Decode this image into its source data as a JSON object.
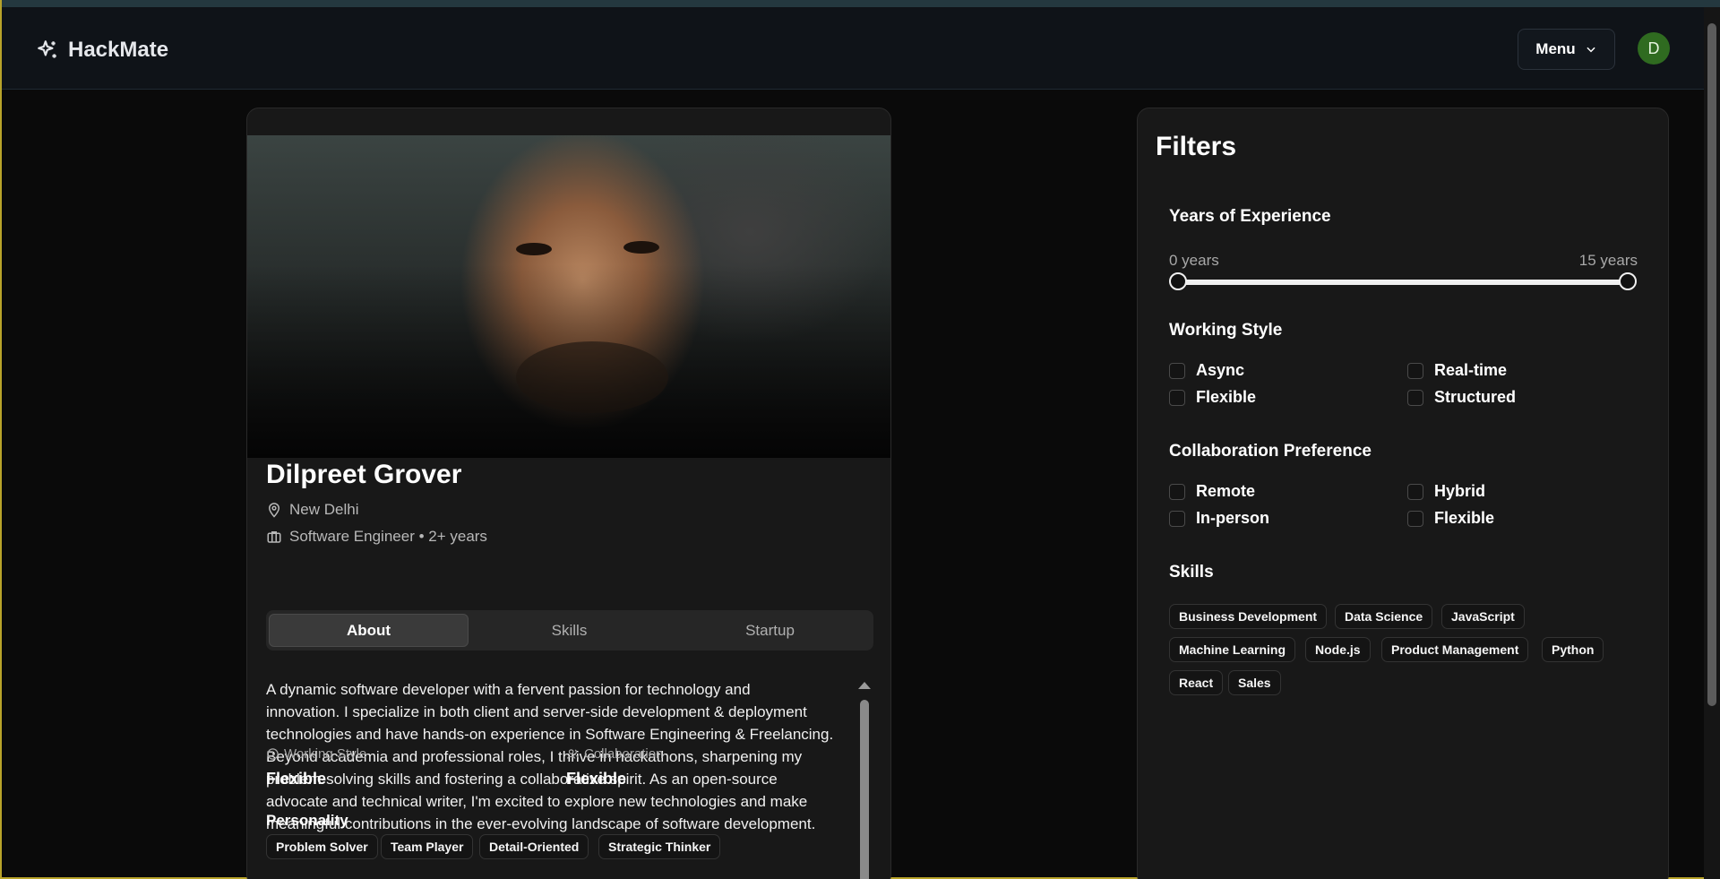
{
  "nav": {
    "brand": "HackMate",
    "menu_label": "Menu",
    "avatar_initial": "D"
  },
  "profile": {
    "name": "Dilpreet Grover",
    "location": "New Delhi",
    "role_line": "Software Engineer • 2+ years",
    "tabs": [
      "About",
      "Skills",
      "Startup"
    ],
    "active_tab": "About",
    "about_lines": [
      "A dynamic software developer with a fervent passion for technology and",
      "innovation. I specialize in both client and server-side development & deployment",
      "technologies and have hands-on experience in Software Engineering & Freelancing.",
      "Beyond academia and professional roles, I thrive in hackathons, sharpening my",
      "problem-solving skills and fostering a collaborative spirit. As an open-source",
      "advocate and technical writer, I'm excited to explore new technologies and make",
      "meaningful contributions in the ever-evolving landscape of software development."
    ],
    "working_style": {
      "label": "Working Style",
      "value": "Flexible"
    },
    "collaboration": {
      "label": "Collaboration",
      "value": "Flexible"
    },
    "personality_title": "Personality",
    "personality": [
      "Problem Solver",
      "Team Player",
      "Detail-Oriented",
      "Strategic Thinker"
    ]
  },
  "filters": {
    "title": "Filters",
    "experience": {
      "label": "Years of Experience",
      "min_label": "0 years",
      "max_label": "15 years",
      "min": 0,
      "max": 15
    },
    "working_style": {
      "label": "Working Style",
      "options": [
        "Async",
        "Real-time",
        "Flexible",
        "Structured"
      ]
    },
    "collaboration": {
      "label": "Collaboration Preference",
      "options": [
        "Remote",
        "Hybrid",
        "In-person",
        "Flexible"
      ]
    },
    "skills": {
      "label": "Skills",
      "options": [
        "Business Development",
        "Data Science",
        "JavaScript",
        "Machine Learning",
        "Node.js",
        "Product Management",
        "Python",
        "React",
        "Sales"
      ]
    }
  },
  "icons": {
    "brand": "sparkles-icon",
    "menu": "chevron-down-icon",
    "location": "map-pin-icon",
    "role": "briefcase-icon",
    "working_style": "clock-icon",
    "collaboration": "users-icon"
  },
  "colors": {
    "background": "#0a0a0a",
    "card": "#181818",
    "avatar": "#2f6b20",
    "navbar": "#0f1318"
  }
}
